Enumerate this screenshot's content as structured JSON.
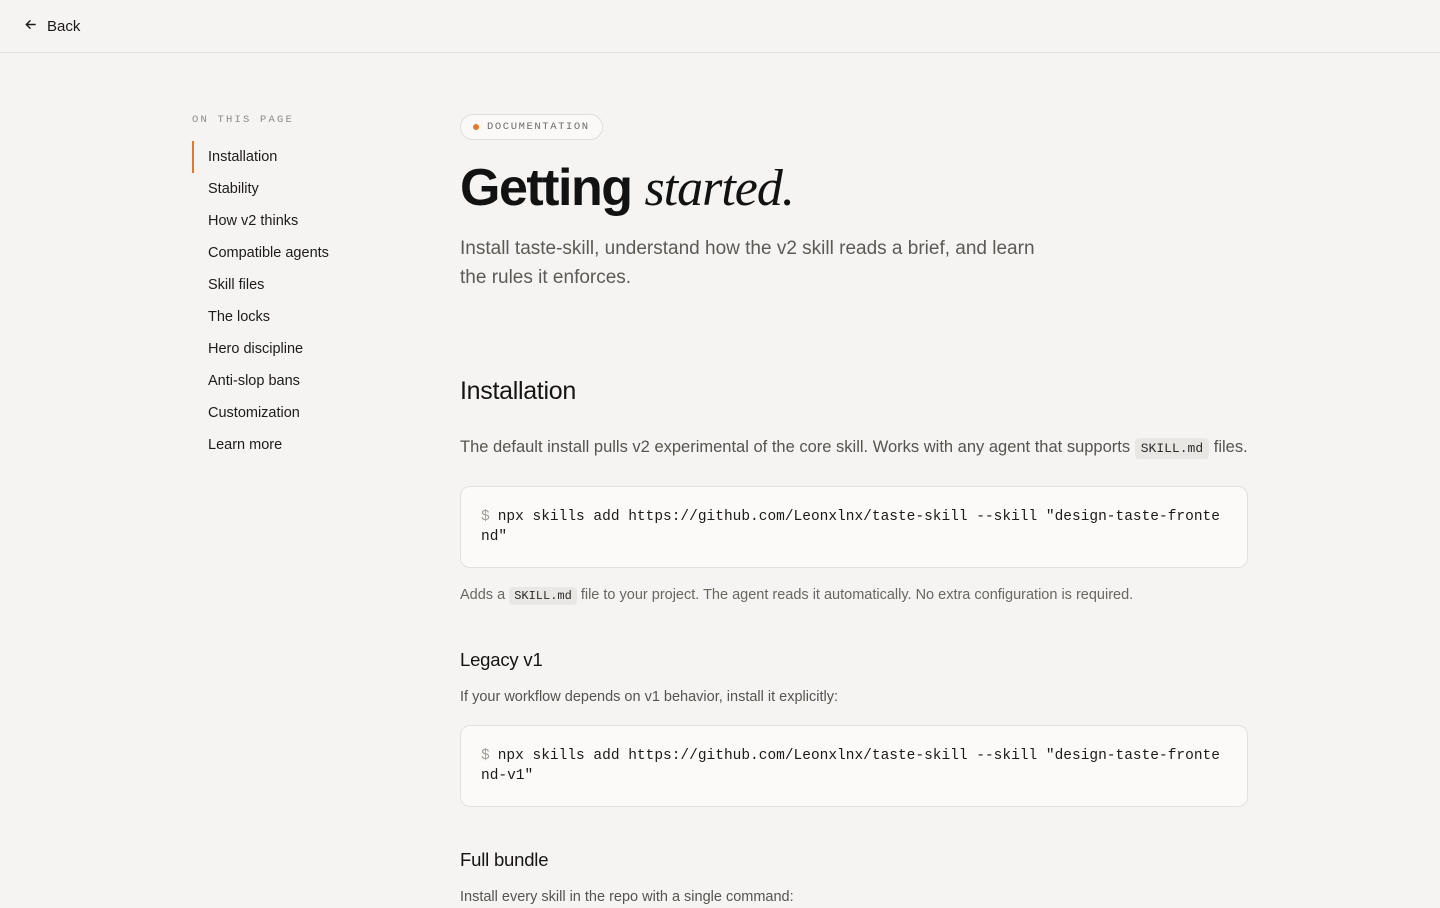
{
  "nav": {
    "back_label": "Back"
  },
  "toc": {
    "heading": "ON THIS PAGE",
    "items": [
      {
        "label": "Installation"
      },
      {
        "label": "Stability"
      },
      {
        "label": "How v2 thinks"
      },
      {
        "label": "Compatible agents"
      },
      {
        "label": "Skill files"
      },
      {
        "label": "The locks"
      },
      {
        "label": "Hero discipline"
      },
      {
        "label": "Anti-slop bans"
      },
      {
        "label": "Customization"
      },
      {
        "label": "Learn more"
      }
    ],
    "active_index": 0
  },
  "hero": {
    "badge": "DOCUMENTATION",
    "title_main": "Getting",
    "title_accent": "started.",
    "lead": "Install taste-skill, understand how the v2 skill reads a brief, and learn the rules it enforces."
  },
  "installation": {
    "heading": "Installation",
    "intro_before": "The default install pulls v2 experimental of the core skill. Works with any agent that supports",
    "intro_code": "SKILL.md",
    "intro_after": "files.",
    "command_prompt": "$",
    "command": "npx skills add https://github.com/Leonxlnx/taste-skill --skill \"design-taste-frontend\"",
    "note_before": "Adds a",
    "note_code": "SKILL.md",
    "note_after": "file to your project. The agent reads it automatically. No extra configuration is required."
  },
  "legacy": {
    "heading": "Legacy v1",
    "text": "If your workflow depends on v1 behavior, install it explicitly:",
    "command_prompt": "$",
    "command": "npx skills add https://github.com/Leonxlnx/taste-skill --skill \"design-taste-frontend-v1\""
  },
  "bundle": {
    "heading": "Full bundle",
    "text": "Install every skill in the repo with a single command:"
  },
  "colors": {
    "accent": "#e07a2f",
    "background": "#f5f4f2",
    "code_background": "#fbfaf8"
  }
}
